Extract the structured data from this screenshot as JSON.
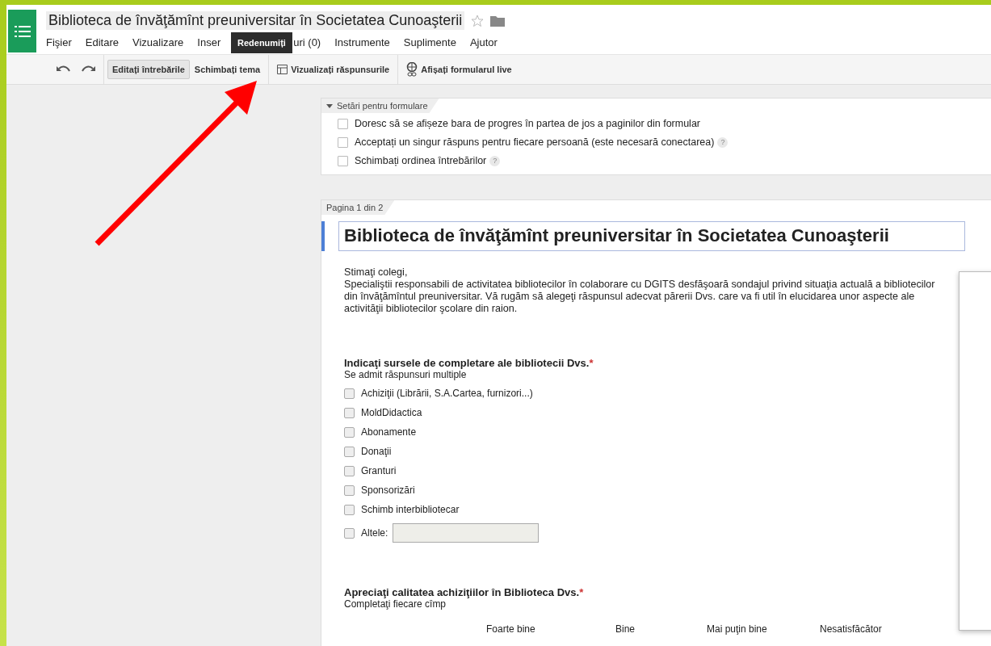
{
  "document_title": "Biblioteca de învăţămînt preuniversitar în Societatea Cunoaşterii",
  "menu": [
    "Fişier",
    "Editare",
    "Vizualizare",
    "Inser",
    "uri (0)",
    "Instrumente",
    "Suplimente",
    "Ajutor"
  ],
  "tooltip": "Redenumiți",
  "toolbar": [
    {
      "kind": "toggle",
      "label": "Editați întrebările",
      "selected": true
    },
    {
      "kind": "toggle",
      "label": "Schimbați tema",
      "selected": false
    },
    {
      "kind": "table",
      "label": "Vizualizați răspunsurile"
    },
    {
      "kind": "globe",
      "label": "Afișați formularul live"
    }
  ],
  "settings": {
    "heading": "Setări pentru formulare",
    "expanded": true,
    "options": [
      {
        "label": "Doresc să se afișeze bara de progres în partea de jos a paginilor din formular",
        "checked": false
      },
      {
        "label": "Acceptați un singur răspuns pentru fiecare persoană (este necesară conectarea)",
        "checked": false,
        "help": "?"
      },
      {
        "label": "Schimbați ordinea întrebărilor",
        "checked": false,
        "help": "?"
      }
    ]
  },
  "page": {
    "tab": "Pagina 1 din 2",
    "title": "Biblioteca de învăţămînt preuniversitar în Societatea Cunoaşterii",
    "description": [
      "Stimaţi colegi,",
      "Specialiştii responsabili de activitatea bibliotecilor în colaborare cu DGITS desfăşoară sondajul privind situaţia actuală a bibliotecilor din învăţămîntul preuniversitar. Vă rugăm să alegeţi răspunsul adecvat părerii Dvs. care va fi util în elucidarea unor aspecte ale activităţii bibliotecilor şcolare din raion."
    ],
    "questions": [
      {
        "kind": "checkboxes",
        "title": "Indicaţi sursele de completare ale bibliotecii Dvs.",
        "required_mark": "*",
        "help": "Se admit răspunsuri multiple",
        "options": [
          {
            "label": "Achiziţii (Librării, S.A.Cartea, furnizori...)",
            "checked": false
          },
          {
            "label": "MoldDidactica",
            "checked": false
          },
          {
            "label": "Abonamente",
            "checked": false
          },
          {
            "label": "Donaţii",
            "checked": false
          },
          {
            "label": "Granturi",
            "checked": false
          },
          {
            "label": "Sponsorizări",
            "checked": false
          },
          {
            "label": "Schimb interbibliotecar",
            "checked": false
          },
          {
            "label": "Altele:",
            "checked": false,
            "other_field": true
          }
        ]
      },
      {
        "kind": "grid",
        "title": "Apreciaţi calitatea achiziţiilor în Biblioteca Dvs.",
        "required_mark": "*",
        "help": "Completaţi fiecare cîmp",
        "columns": [
          "Foarte bine",
          "Bine",
          "Mai puţin bine",
          "Nesatisfăcător"
        ]
      }
    ]
  }
}
